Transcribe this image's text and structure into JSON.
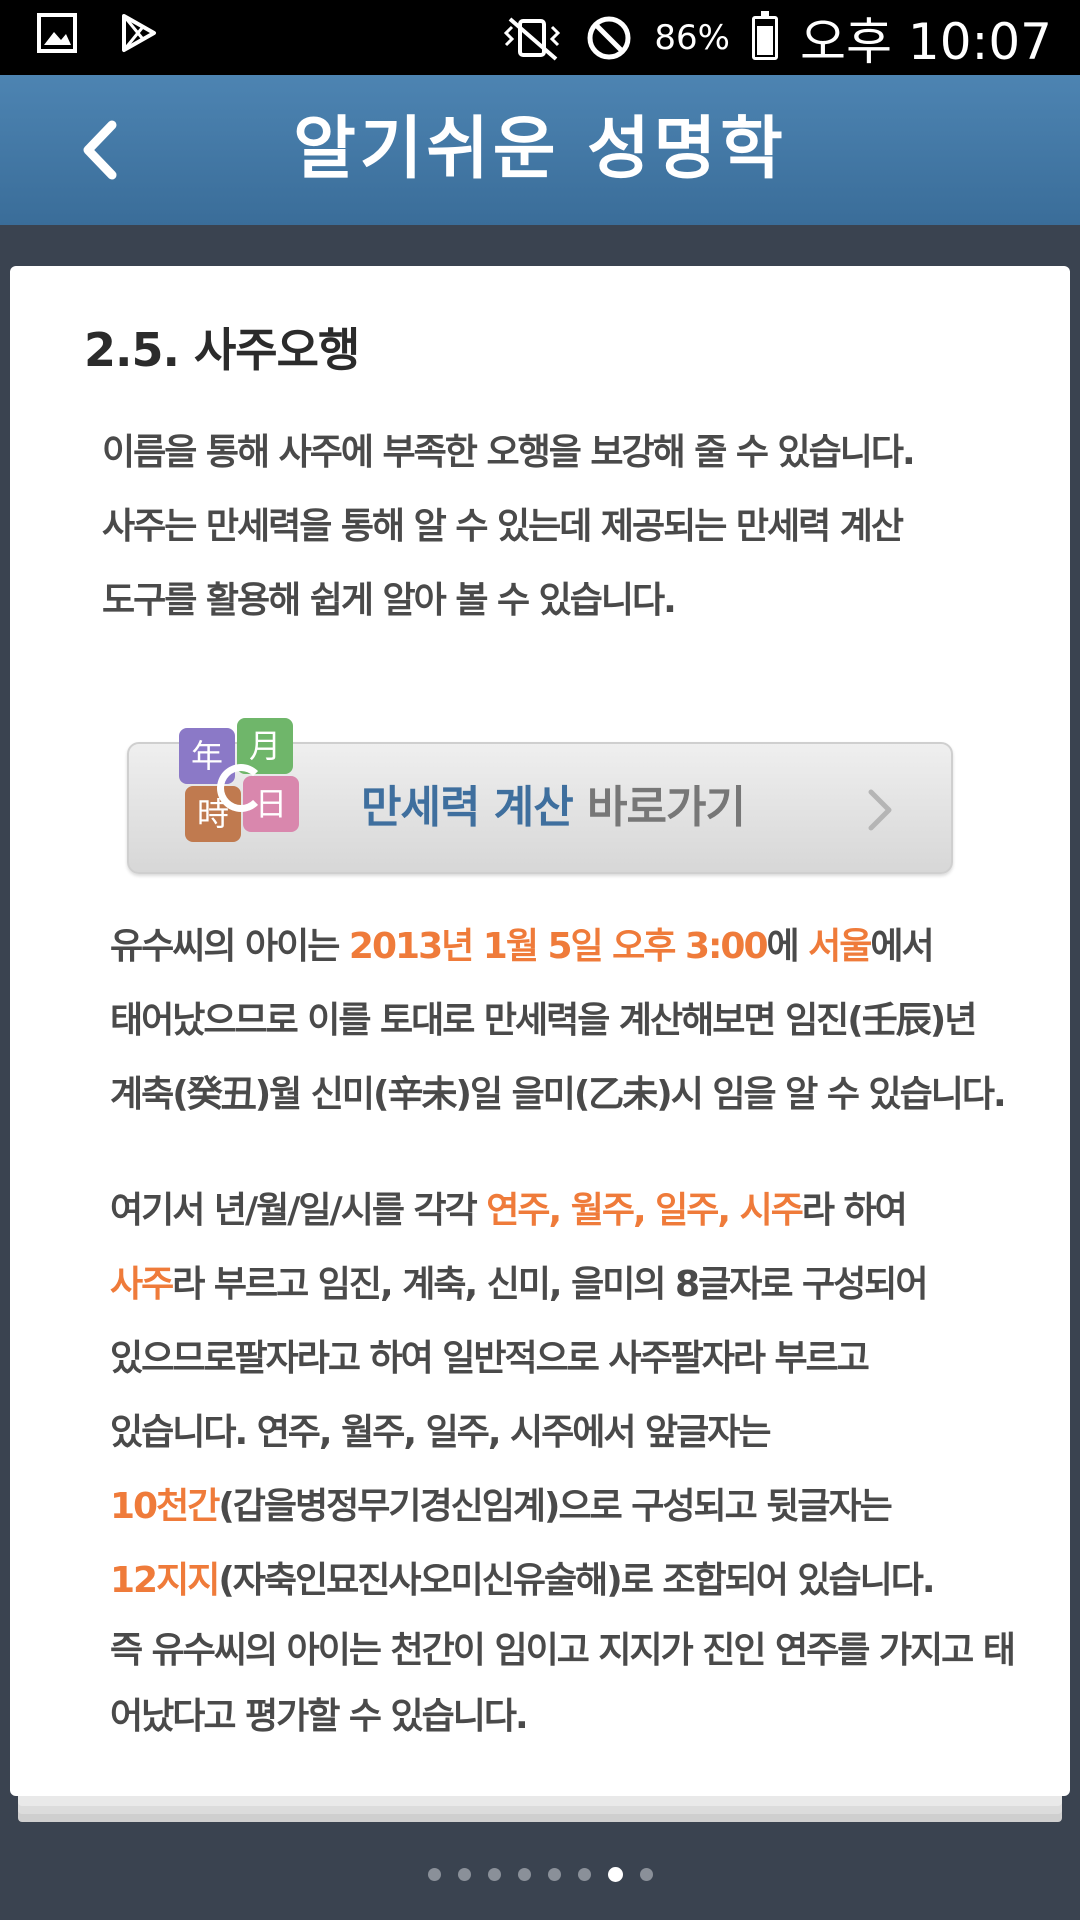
{
  "status_bar": {
    "left_icons": [
      "image-icon",
      "play-store-icon"
    ],
    "right_icons": [
      "vibrate-icon",
      "do-not-disturb-icon",
      "battery-icon"
    ],
    "battery_percent": "86%",
    "battery_level": 0.86,
    "time": "오후 10:07"
  },
  "app_bar": {
    "title": "알기쉬운 성명학",
    "back_icon": "chevron-left-icon"
  },
  "content": {
    "section_title": "2.5.  사주오행",
    "intro_lines": [
      "이름을 통해 사주에 부족한 오행을 보강해 줄 수 있습니다.",
      "사주는 만세력을 통해 알 수 있는데 제공되는 만세력 계산",
      "도구를 활용해 쉽게 알아 볼 수 있습니다."
    ],
    "manse_button": {
      "label_strong": "만세력 계산",
      "label_rest": " 바로가기",
      "icon_chars": [
        "年",
        "月",
        "時",
        "日"
      ]
    },
    "p1": {
      "l1_a": "유수씨의 아이는 ",
      "l1_b": "2013년 1월 5일 오후 3:00",
      "l1_c": "에 ",
      "l1_d": "서울",
      "l1_e": "에서",
      "l2": "태어났으므로 이를 토대로 만세력을 계산해보면 임진(壬辰)년",
      "l3": "계축(癸丑)월 신미(辛未)일 을미(乙未)시 임을 알 수 있습니다."
    },
    "p2": {
      "l1_a": "여기서 년/월/일/시를 각각 ",
      "l1_b": "연주, 월주, 일주, 시주",
      "l1_c": "라 하여",
      "l2_a": "사주",
      "l2_b": "라 부르고 임진, 계축, 신미, 을미의 8글자로 구성되어",
      "l3": "있으므로팔자라고 하여 일반적으로 사주팔자라 부르고",
      "l4": "있습니다. 연주, 월주, 일주, 시주에서 앞글자는",
      "l5_a": "10천간",
      "l5_b": "(갑을병정무기경신임계)으로 구성되고 뒷글자는",
      "l6_a": "12지지",
      "l6_b": "(자축인묘진사오미신유술해)로 조합되어 있습니다.",
      "l7": "즉 유수씨의 아이는 천간이 임이고 지지가 진인 연주를 가지고 태",
      "l8": "어났다고 평가할 수 있습니다."
    }
  },
  "pager": {
    "total": 8,
    "active_index": 6
  },
  "colors": {
    "app_bar": "#4479a6",
    "highlight": "#ef7b3a",
    "background": "#3a4350"
  }
}
